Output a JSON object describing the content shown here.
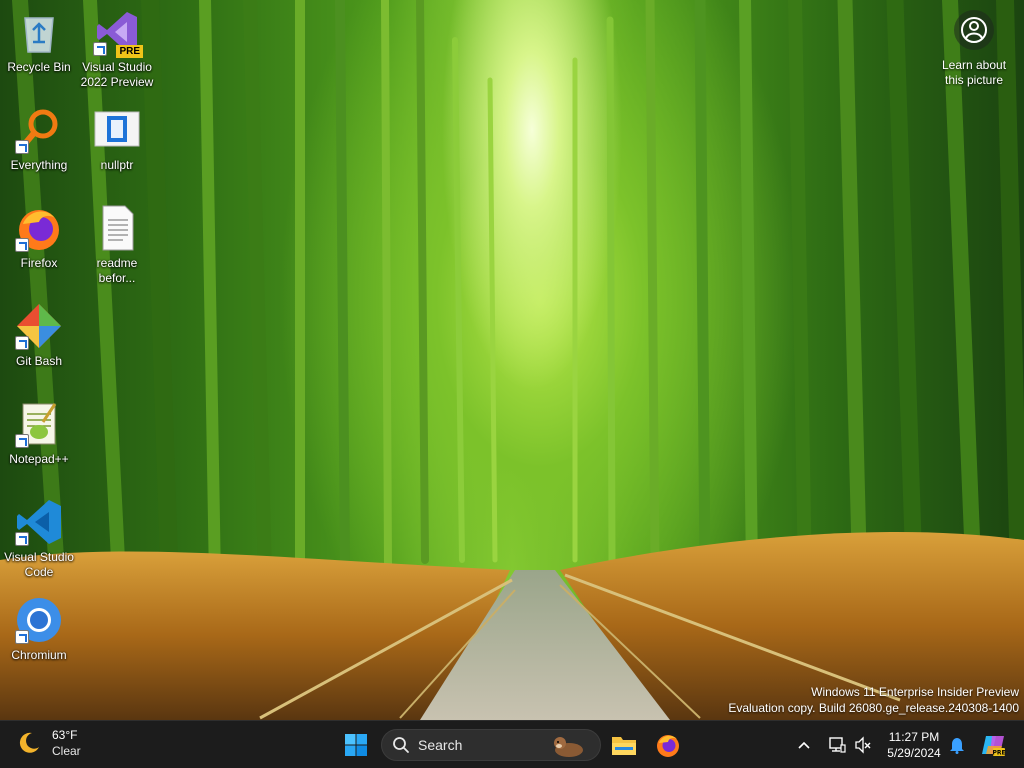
{
  "desktop": {
    "icons": [
      {
        "label": "Recycle Bin",
        "icon": "recycle-bin-icon"
      },
      {
        "label": "Visual Studio 2022 Preview",
        "icon": "visual-studio-icon",
        "badge": "PRE"
      },
      {
        "label": "Everything",
        "icon": "everything-search-icon"
      },
      {
        "label": "nullptr",
        "icon": "folder-document-icon"
      },
      {
        "label": "Firefox",
        "icon": "firefox-icon"
      },
      {
        "label": "readme befor...",
        "icon": "text-file-icon"
      },
      {
        "label": "Git Bash",
        "icon": "git-bash-icon"
      },
      {
        "label": "Notepad++",
        "icon": "notepad-plus-plus-icon"
      },
      {
        "label": "Visual Studio Code",
        "icon": "vscode-icon"
      },
      {
        "label": "Chromium",
        "icon": "chromium-icon"
      }
    ],
    "learn_picture": {
      "label": "Learn about this picture",
      "icon": "camera-info-icon"
    },
    "watermark": {
      "line1": "Windows 11 Enterprise Insider Preview",
      "line2": "Evaluation copy. Build 26080.ge_release.240308-1400"
    }
  },
  "taskbar": {
    "weather": {
      "temp": "63°F",
      "condition": "Clear",
      "icon": "moon-icon"
    },
    "search": {
      "placeholder": "Search",
      "icon": "search-icon"
    },
    "pinned": [
      {
        "name": "File Explorer",
        "icon": "file-explorer-icon"
      },
      {
        "name": "Firefox",
        "icon": "firefox-icon"
      }
    ],
    "clock": {
      "time": "11:27 PM",
      "date": "5/29/2024"
    },
    "colors": {
      "background": "#1c1c1c",
      "accent": "#0078d4"
    }
  }
}
